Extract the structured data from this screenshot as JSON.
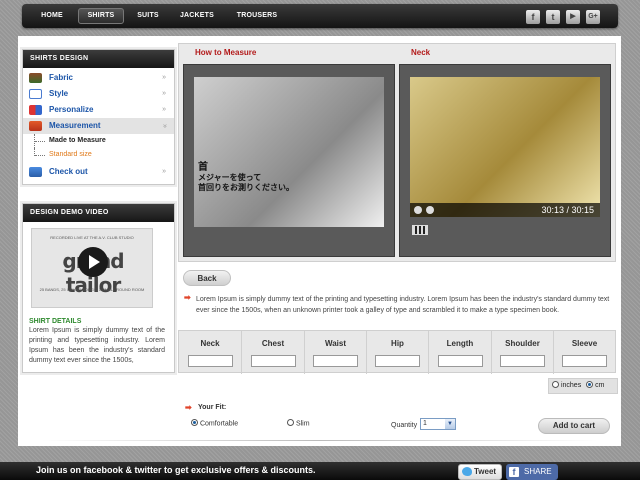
{
  "nav": {
    "items": [
      "HOME",
      "SHIRTS",
      "SUITS",
      "JACKETS",
      "TROUSERS"
    ],
    "active": "SHIRTS",
    "social_icons": [
      "facebook-icon",
      "twitter-icon",
      "youtube-icon",
      "google-plus-icon"
    ],
    "social_glyphs": [
      "f",
      "t",
      "▶",
      "G+"
    ]
  },
  "sidebar": {
    "title": "SHIRTS DESIGN",
    "items": [
      {
        "label": "Fabric",
        "icon": "fabric-icon"
      },
      {
        "label": "Style",
        "icon": "style-icon"
      },
      {
        "label": "Personalize",
        "icon": "personalize-icon"
      },
      {
        "label": "Measurement",
        "icon": "measurement-icon"
      },
      {
        "label": "Check out",
        "icon": "checkout-icon"
      }
    ],
    "submenu": [
      "Made to Measure",
      "Standard size"
    ],
    "arrow_closed": "»",
    "arrow_open": "»"
  },
  "video_box": {
    "title": "DESIGN DEMO VIDEO",
    "thumb_top_text": "RECORDED LIVE AT THE A.V. CLUB STUDIO",
    "thumb_logo": "grand tailor",
    "thumb_bottom_text": "25 BANDS, 25 COVER SONGS, 1 SMALL ROUND ROOM",
    "details_title": "SHIRT DETAILS",
    "details_text": "Lorem Ipsum is simply dummy text of the printing and typesetting industry. Lorem Ipsum has been the industry's standard dummy text ever since the 1500s,"
  },
  "how_to": {
    "title": "How to Measure",
    "caption_line1": "首",
    "caption_line2": "メジャーを使って",
    "caption_line3": "首回りをお測りください。"
  },
  "neck": {
    "title": "Neck",
    "time": "30:13 / 30:15",
    "progress": 0.95
  },
  "back_label": "Back",
  "description": "Lorem Ipsum is simply dummy text of the printing and typesetting industry. Lorem Ipsum has been the industry's standard dummy text ever since the 1500s, when an unknown printer took a galley of type and scrambled it to make a type specimen book.",
  "measurements": {
    "columns": [
      "Neck",
      "Chest",
      "Waist",
      "Hip",
      "Length",
      "Shoulder",
      "Sleeve"
    ]
  },
  "units": {
    "inches": "inches",
    "cm": "cm",
    "selected": "cm"
  },
  "fit": {
    "label": "Your Fit:",
    "comfortable": "Comfortable",
    "slim": "Slim",
    "selected": "Comfortable"
  },
  "quantity": {
    "label": "Quantity",
    "value": "1"
  },
  "addcart_label": "Add to cart",
  "footer": {
    "text": "Join us on facebook & twitter to get exclusive offers & discounts.",
    "tweet": "Tweet",
    "share": "SHARE"
  },
  "colors": {
    "accent_red": "#b31b1b",
    "link_blue": "#1c55a8",
    "green_title": "#2f8a2f",
    "orange_sub": "#e07a1a"
  }
}
